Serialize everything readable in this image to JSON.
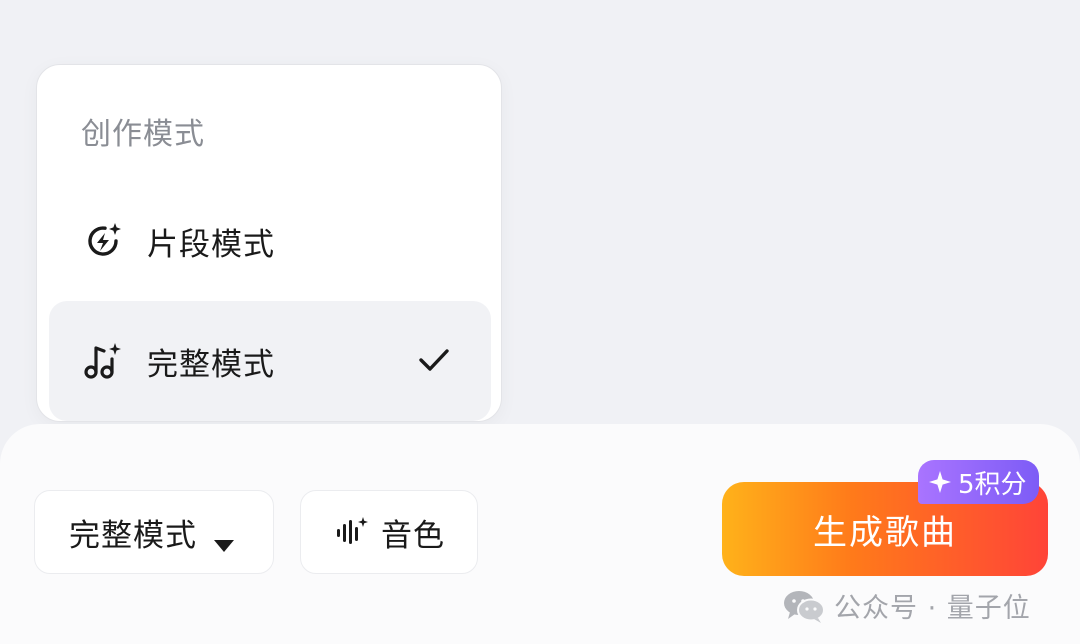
{
  "menu": {
    "title": "创作模式",
    "items": [
      {
        "label": "片段模式",
        "icon": "lightning-sparkle-icon",
        "selected": false
      },
      {
        "label": "完整模式",
        "icon": "music-note-sparkle-icon",
        "selected": true
      }
    ]
  },
  "toolbar": {
    "mode_label": "完整模式",
    "voice_label": "音色",
    "generate_label": "生成歌曲",
    "credits_badge": "5积分"
  },
  "watermark": {
    "text": "公众号 · 量子位"
  },
  "colors": {
    "background": "#f0f1f5",
    "generate_gradient_start": "#ffb21a",
    "generate_gradient_end": "#ff4438",
    "badge_purple": "#8b63f8",
    "selected_item_bg": "#f1f2f5"
  }
}
